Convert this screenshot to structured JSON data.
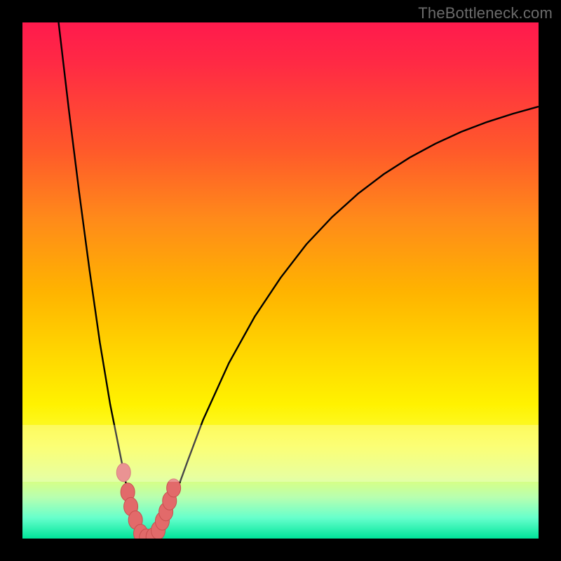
{
  "watermark": "TheBottleneck.com",
  "colors": {
    "frame": "#000000",
    "curve": "#000000",
    "marker_fill": "#e26a6a",
    "marker_stroke": "#c94f4f",
    "gradient_top": "#ff1a4d",
    "gradient_bottom": "#00e59a"
  },
  "chart_data": {
    "type": "line",
    "title": "",
    "xlabel": "",
    "ylabel": "",
    "xlim": [
      0,
      100
    ],
    "ylim": [
      0,
      100
    ],
    "grid": false,
    "legend": "none",
    "curves": [
      {
        "name": "left_branch",
        "x": [
          7,
          9,
          11,
          13,
          15,
          17,
          18,
          19,
          19.8,
          20.5,
          21,
          21.5,
          22,
          22.5,
          23
        ],
        "y": [
          100,
          83,
          67,
          52,
          38,
          26,
          21,
          16,
          12,
          8.5,
          6,
          4,
          2.5,
          1.2,
          0.5
        ]
      },
      {
        "name": "valley",
        "x": [
          23,
          23.5,
          24,
          24.5,
          25,
          25.5,
          26,
          26.5,
          27
        ],
        "y": [
          0.5,
          0.15,
          0.05,
          0,
          0.05,
          0.15,
          0.5,
          1.2,
          2.2
        ]
      },
      {
        "name": "right_branch",
        "x": [
          27,
          28,
          29,
          30,
          32,
          35,
          40,
          45,
          50,
          55,
          60,
          65,
          70,
          75,
          80,
          85,
          90,
          95,
          100
        ],
        "y": [
          2.2,
          4.3,
          6.8,
          9.5,
          15,
          23,
          34,
          43,
          50.5,
          57,
          62.3,
          66.8,
          70.6,
          73.8,
          76.5,
          78.8,
          80.7,
          82.3,
          83.7
        ]
      }
    ],
    "markers": {
      "name": "highlighted_points",
      "x": [
        19.6,
        20.4,
        21.0,
        21.9,
        22.9,
        24.0,
        25.3,
        26.3,
        27.1,
        27.8,
        28.5,
        29.3
      ],
      "y": [
        12.8,
        9.0,
        6.2,
        3.6,
        1.0,
        0.1,
        0.3,
        1.6,
        3.4,
        5.2,
        7.3,
        9.8
      ]
    }
  }
}
